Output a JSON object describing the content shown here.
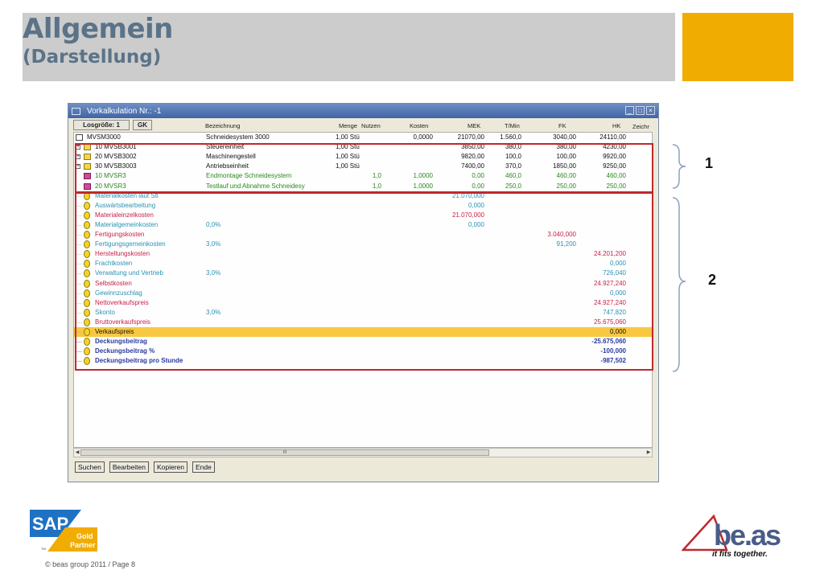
{
  "slide": {
    "title_line1": "Allgemein",
    "title_line2": "(Darstellung)",
    "accent_color": "#f0ac00",
    "footer": "© beas group 2011 / Page 8",
    "callouts": [
      "1",
      "2"
    ]
  },
  "window": {
    "title": "Vorkalkulation Nr.: -1",
    "buttons": {
      "losgroesse": "Losgröße: 1",
      "gk": "GK"
    },
    "columns": {
      "bezeichnung": "Bezeichnung",
      "menge": "Menge",
      "nutzen": "Nutzen",
      "kosten": "Kosten",
      "mek": "MEK",
      "tmin": "T/Min",
      "fk": "FK",
      "hk": "HK",
      "zeichn": "Zeichr"
    },
    "structure_rows": [
      {
        "item": "MVSM3000",
        "bezeichnung": "Schneidesystem 3000",
        "menge": "1,00 Stü",
        "nutzen": "",
        "kosten": "0,0000",
        "mek": "21070,00",
        "tmin": "1.560,0",
        "fk": "3040,00",
        "hk": "24110,00",
        "color": "#111111"
      },
      {
        "item": "10  MVSB3001",
        "bezeichnung": "Steuereinheit",
        "menge": "1,00 Stü",
        "nutzen": "",
        "kosten": "",
        "mek": "3850,00",
        "tmin": "380,0",
        "fk": "380,00",
        "hk": "4230,00",
        "color": "#111111"
      },
      {
        "item": "20  MVSB3002",
        "bezeichnung": "Maschinengestell",
        "menge": "1,00 Stü",
        "nutzen": "",
        "kosten": "",
        "mek": "9820,00",
        "tmin": "100,0",
        "fk": "100,00",
        "hk": "9920,00",
        "color": "#111111"
      },
      {
        "item": "30  MVSB3003",
        "bezeichnung": "Antriebseinheit",
        "menge": "1,00 Stü",
        "nutzen": "",
        "kosten": "",
        "mek": "7400,00",
        "tmin": "370,0",
        "fk": "1850,00",
        "hk": "9250,00",
        "color": "#111111"
      },
      {
        "item": "10  MVSR3",
        "bezeichnung": "Endmontage Schneidesystem",
        "menge": "",
        "nutzen": "1,0",
        "kosten": "1,0000",
        "mek": "0,00",
        "tmin": "460,0",
        "fk": "460,00",
        "hk": "460,00",
        "color": "#2a8a1c"
      },
      {
        "item": "20  MVSR3",
        "bezeichnung": "Testlauf und Abnahme Schneidesy",
        "menge": "",
        "nutzen": "1,0",
        "kosten": "1,0000",
        "mek": "0,00",
        "tmin": "250,0",
        "fk": "250,00",
        "hk": "250,00",
        "color": "#2a8a1c"
      }
    ],
    "cost_rows": [
      {
        "label": "Materialkosten laut Stl",
        "pct": "",
        "mek": "21.070,000",
        "fk": "",
        "hk": "",
        "color": "#2a92b4"
      },
      {
        "label": "Auswärtsbearbeitung",
        "pct": "",
        "mek": "0,000",
        "fk": "",
        "hk": "",
        "color": "#2a92b4"
      },
      {
        "label": "Materialeinzelkosten",
        "pct": "",
        "mek": "21.070,000",
        "fk": "",
        "hk": "",
        "color": "#c8214a"
      },
      {
        "label": "Materialgemeinkosten",
        "pct": "0,0%",
        "mek": "0,000",
        "fk": "",
        "hk": "",
        "color": "#2a92b4"
      },
      {
        "label": "Fertigungskosten",
        "pct": "",
        "mek": "",
        "fk": "3.040,000",
        "hk": "",
        "color": "#c8214a"
      },
      {
        "label": "Fertigungsgemeinkosten",
        "pct": "3,0%",
        "mek": "",
        "fk": "91,200",
        "hk": "",
        "color": "#2a92b4"
      },
      {
        "label": "Herstellungskosten",
        "pct": "",
        "mek": "",
        "fk": "",
        "hk": "24.201,200",
        "color": "#c8214a"
      },
      {
        "label": "Frachtkosten",
        "pct": "",
        "mek": "",
        "fk": "",
        "hk": "0,000",
        "color": "#2a92b4"
      },
      {
        "label": "Verwaltung und Vertrieb",
        "pct": "3,0%",
        "mek": "",
        "fk": "",
        "hk": "726,040",
        "color": "#2a92b4"
      },
      {
        "label": "Selbstkosten",
        "pct": "",
        "mek": "",
        "fk": "",
        "hk": "24.927,240",
        "color": "#c8214a"
      },
      {
        "label": "Gewinnzuschlag",
        "pct": "",
        "mek": "",
        "fk": "",
        "hk": "0,000",
        "color": "#2a92b4"
      },
      {
        "label": "Nettoverkaufspreis",
        "pct": "",
        "mek": "",
        "fk": "",
        "hk": "24.927,240",
        "color": "#c8214a"
      },
      {
        "label": "Skonto",
        "pct": "3,0%",
        "mek": "",
        "fk": "",
        "hk": "747,820",
        "color": "#2a92b4"
      },
      {
        "label": "Bruttoverkaufspreis",
        "pct": "",
        "mek": "",
        "fk": "",
        "hk": "25.675,060",
        "color": "#c8214a"
      },
      {
        "label": "Verkaufspreis",
        "pct": "",
        "mek": "",
        "fk": "",
        "hk": "0,000",
        "color": "#111111",
        "highlight": true
      },
      {
        "label": "Deckungsbeitrag",
        "pct": "",
        "mek": "",
        "fk": "",
        "hk": "-25.675,060",
        "color": "#2a3aa0"
      },
      {
        "label": "Deckungsbeitrag %",
        "pct": "",
        "mek": "",
        "fk": "",
        "hk": "-100,000",
        "color": "#2a3aa0"
      },
      {
        "label": "Deckungsbeitrag pro Stunde",
        "pct": "",
        "mek": "",
        "fk": "",
        "hk": "-987,502",
        "color": "#2a3aa0"
      }
    ],
    "scroll_thumb_mark": "III",
    "footer_buttons": [
      "Suchen",
      "Bearbeiten",
      "Kopieren",
      "Ende"
    ]
  },
  "logos": {
    "sap_text": "SAP",
    "sap_badge_line1": "Gold",
    "sap_badge_line2": "Partner",
    "sap_tm": "TM",
    "beas_text": "be.as",
    "beas_tagline": "it fits together."
  }
}
